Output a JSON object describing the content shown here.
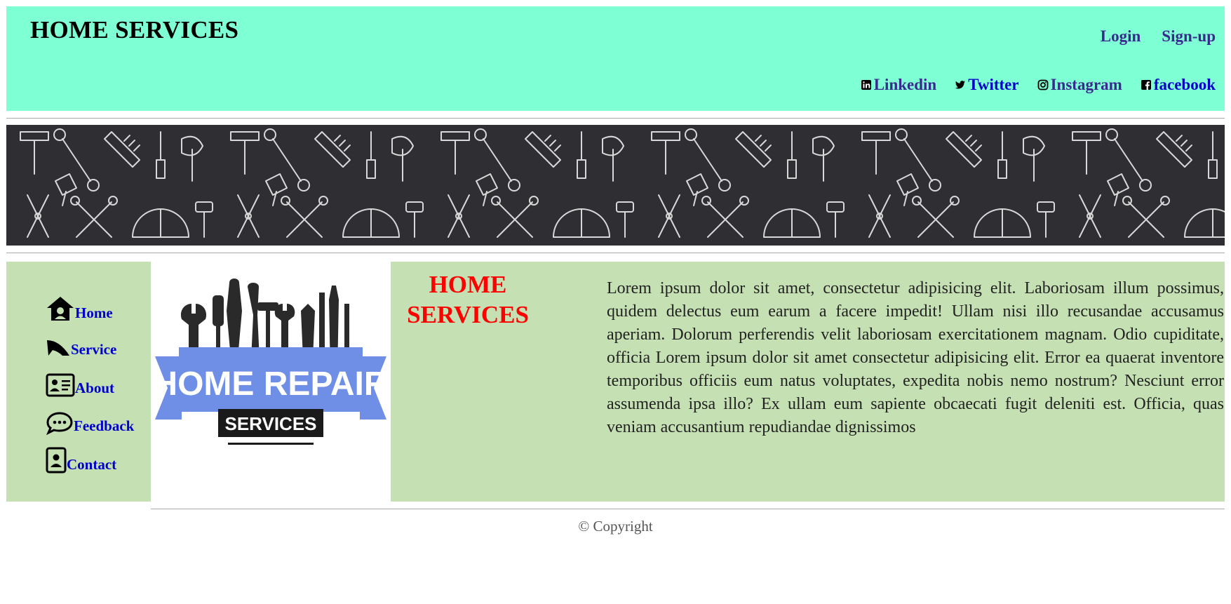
{
  "header": {
    "title": "HOME SERVICES",
    "auth": {
      "login": "Login",
      "signup": "Sign-up"
    },
    "social": [
      {
        "label": "Linkedin",
        "icon": "linkedin-icon"
      },
      {
        "label": "Twitter",
        "icon": "twitter-icon"
      },
      {
        "label": "Instagram",
        "icon": "instagram-icon"
      },
      {
        "label": "facebook",
        "icon": "facebook-icon"
      }
    ]
  },
  "banner": {
    "pattern": "tools-pattern"
  },
  "sidebar": {
    "items": [
      {
        "label": "Home",
        "icon": "house-icon"
      },
      {
        "label": "Service",
        "icon": "service-icon"
      },
      {
        "label": "About",
        "icon": "id-card-icon"
      },
      {
        "label": "Feedback",
        "icon": "chat-bubble-icon"
      },
      {
        "label": "Contact",
        "icon": "contact-card-icon"
      }
    ]
  },
  "logo": {
    "text_main": "HOME REPAIR",
    "text_sub": "SERVICES"
  },
  "main": {
    "title_line1": "HOME",
    "title_line2": "SERVICES",
    "body": "Lorem ipsum dolor sit amet, consectetur adipisicing elit. Laboriosam illum possimus, quidem delectus eum earum a facere impedit! Ullam nisi illo recusandae accusamus aperiam. Dolorum perferendis velit laboriosam exercitationem magnam. Odio cupiditate, officia Lorem ipsum dolor sit amet consectetur adipisicing elit. Error ea quaerat inventore temporibus officiis eum natus voluptates, expedita nobis nemo nostrum? Nesciunt error assumenda ipsa illo? Ex ullam eum sapiente obcaecati fugit deleniti est. Officia, quas veniam accusantium repudiandae dignissimos"
  },
  "footer": {
    "copyright": "© Copyright"
  },
  "colors": {
    "header_bg": "#7fffd4",
    "panel_bg": "#c5e0b3",
    "title_red": "#ff0000",
    "link_blue": "#0000cc",
    "banner_bg": "#2f2f33",
    "logo_ribbon": "#6f8fe6"
  }
}
